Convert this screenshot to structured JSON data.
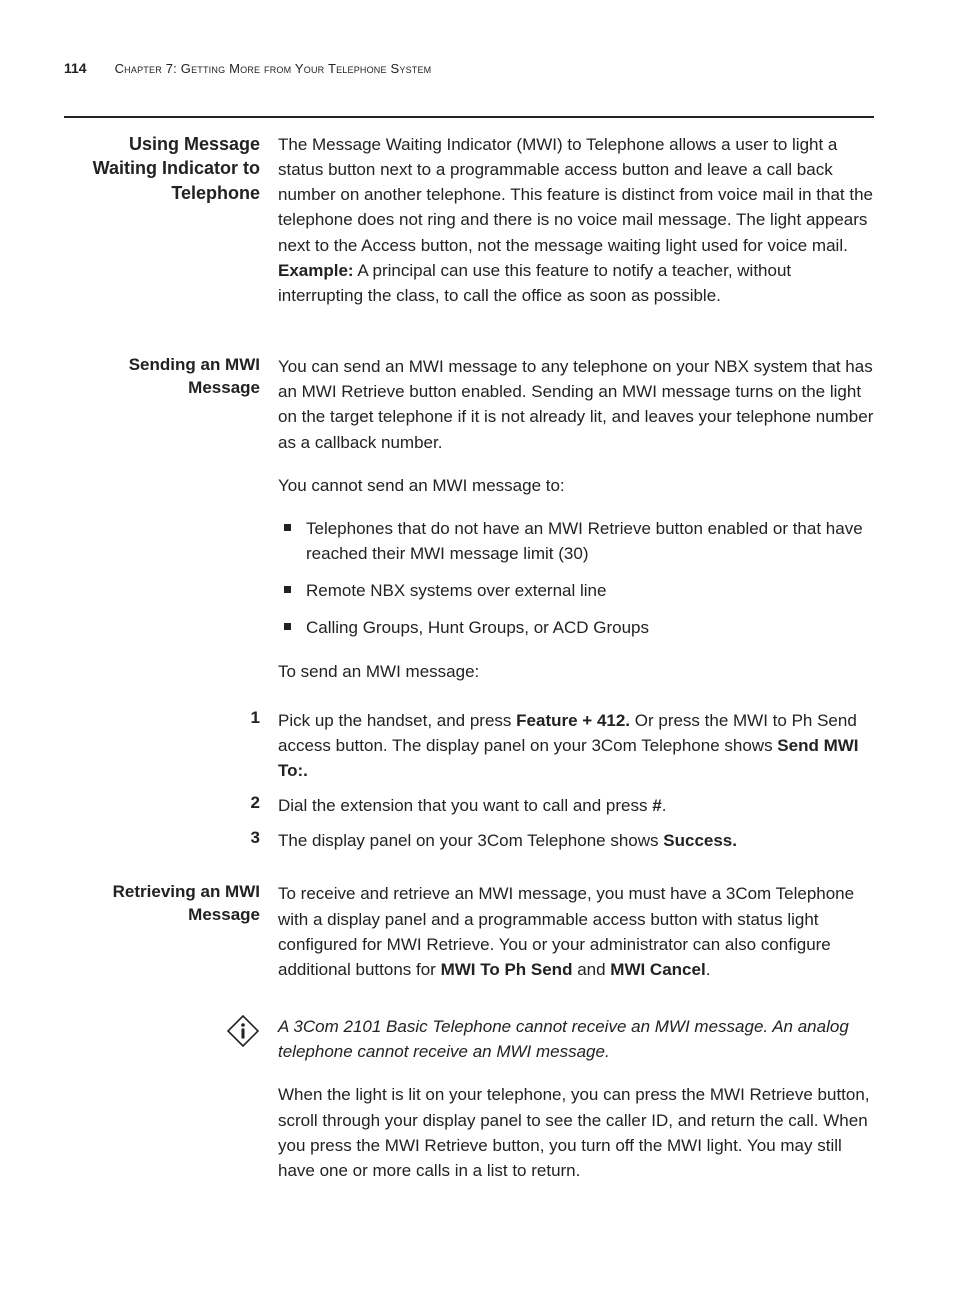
{
  "header": {
    "pageNumber": "114",
    "chapterTitle": "Chapter 7: Getting More from Your Telephone System"
  },
  "section1": {
    "heading": "Using Message Waiting Indicator to Telephone",
    "body1a": "The Message Waiting Indicator (MWI) to Telephone allows a user to light a status button next to a programmable access button and leave a call back number on another telephone. This feature is distinct from voice mail in that the telephone does not ring and there is no voice mail message. The light appears next to the Access button, not the message waiting light used for voice mail. ",
    "exampleLabel": "Example:",
    "body1b": " A principal can use this feature to notify a teacher, without interrupting the class, to call the office as soon as possible."
  },
  "section2": {
    "heading": "Sending an MWI Message",
    "p1": "You can send an MWI message to any telephone on your NBX system that has an MWI Retrieve button enabled. Sending an MWI message turns on the light on the target telephone if it is not already lit, and leaves your telephone number as a callback number.",
    "p2": "You cannot send an MWI message to:",
    "bullets": [
      "Telephones that do not have an MWI Retrieve button enabled or that have reached their MWI message limit (30)",
      "Remote NBX systems over external line",
      "Calling Groups, Hunt Groups, or ACD Groups"
    ],
    "p3": "To send an MWI message:",
    "steps": [
      {
        "pre": "Pick up the handset, and press ",
        "bold1": "Feature + 412.",
        "mid": " Or press the MWI to Ph Send access button. The display panel on your 3Com Telephone shows ",
        "bold2": "Send MWI To:."
      },
      {
        "pre": "Dial the extension that you want to call and press ",
        "bold1": "#",
        "mid": "."
      },
      {
        "pre": "The display panel on your 3Com Telephone shows ",
        "bold1": "Success."
      }
    ]
  },
  "section3": {
    "heading": "Retrieving an MWI Message",
    "p1a": "To receive and retrieve an MWI message, you must have a 3Com Telephone with a display panel and a programmable access button with status light configured for MWI Retrieve. You or your administrator can also configure additional buttons for ",
    "bold1": "MWI To Ph Send",
    "p1b": " and ",
    "bold2": "MWI Cancel",
    "p1c": ".",
    "note": "A 3Com 2101 Basic Telephone cannot receive an MWI message. An analog telephone cannot receive an MWI message.",
    "p2": "When the light is lit on your telephone, you can press the MWI Retrieve button, scroll through your display panel to see the caller ID, and return the call. When you press the MWI Retrieve button, you turn off the MWI light. You may still have one or more calls in a list to return."
  }
}
